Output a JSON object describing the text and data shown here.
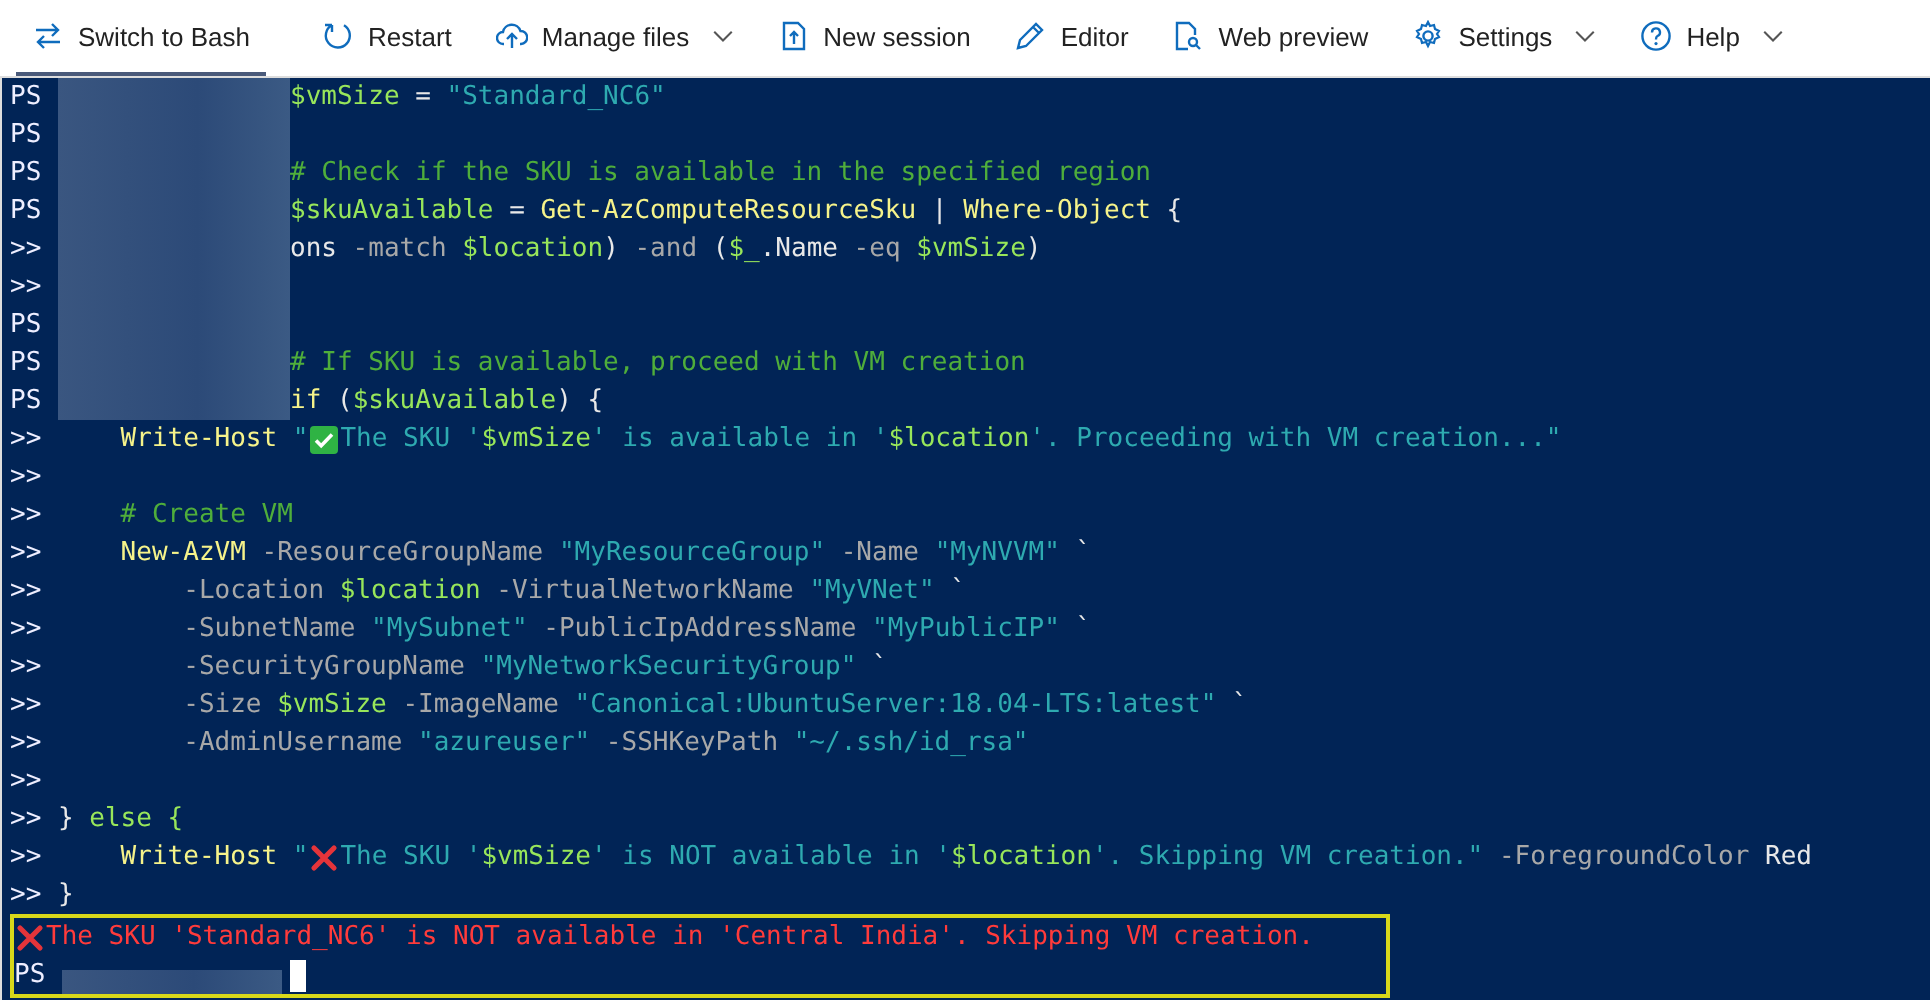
{
  "toolbar": {
    "items": [
      {
        "label": "Switch to Bash",
        "kind": "tab"
      },
      {
        "label": "Restart",
        "kind": "button"
      },
      {
        "label": "Manage files",
        "kind": "menu"
      },
      {
        "label": "New session",
        "kind": "button"
      },
      {
        "label": "Editor",
        "kind": "button"
      },
      {
        "label": "Web preview",
        "kind": "button"
      },
      {
        "label": "Settings",
        "kind": "menu"
      },
      {
        "label": "Help",
        "kind": "menu"
      }
    ]
  },
  "terminal": {
    "lines": [
      {
        "prompt": "PS",
        "redacted": true,
        "tokens": [
          {
            "kind": "var",
            "text": "$vmSize"
          },
          {
            "kind": "plain",
            "text": " = "
          },
          {
            "kind": "str",
            "text": "\"Standard_NC6\""
          }
        ]
      },
      {
        "prompt": "PS",
        "redacted": true
      },
      {
        "prompt": "PS",
        "redacted": true,
        "tokens": [
          {
            "kind": "comment",
            "text": "# Check if the SKU is available in the specified region"
          }
        ]
      },
      {
        "prompt": "PS",
        "redacted": true,
        "tokens": [
          {
            "kind": "var",
            "text": "$skuAvailable"
          },
          {
            "kind": "plain",
            "text": " = "
          },
          {
            "kind": "cmd",
            "text": "Get-AzComputeResourceSku"
          },
          {
            "kind": "plain",
            "text": " | "
          },
          {
            "kind": "cmd",
            "text": "Where-Object"
          },
          {
            "kind": "plain",
            "text": " {"
          }
        ]
      },
      {
        "prompt": ">>",
        "redacted": true,
        "tokens": [
          {
            "kind": "plain",
            "text": "ons"
          },
          {
            "kind": "op",
            "text": " -match "
          },
          {
            "kind": "var",
            "text": "$location"
          },
          {
            "kind": "plain",
            "text": ")"
          },
          {
            "kind": "op",
            "text": " -and "
          },
          {
            "kind": "plain",
            "text": "("
          },
          {
            "kind": "var",
            "text": "$_"
          },
          {
            "kind": "plain",
            "text": ".Name"
          },
          {
            "kind": "op",
            "text": " -eq "
          },
          {
            "kind": "var",
            "text": "$vmSize"
          },
          {
            "kind": "plain",
            "text": ")"
          }
        ]
      },
      {
        "prompt": ">>",
        "redacted": true
      },
      {
        "prompt": "PS",
        "redacted": true
      },
      {
        "prompt": "PS",
        "redacted": true,
        "tokens": [
          {
            "kind": "comment",
            "text": "# If SKU is available, proceed with VM creation"
          }
        ]
      },
      {
        "prompt": "PS",
        "redacted": true,
        "tokens": [
          {
            "kind": "cmd",
            "text": "if"
          },
          {
            "kind": "plain",
            "text": " ("
          },
          {
            "kind": "var",
            "text": "$skuAvailable"
          },
          {
            "kind": "plain",
            "text": ") {"
          }
        ]
      },
      {
        "prompt": ">>",
        "tokens": [
          {
            "kind": "cmd",
            "text": "    Write-Host"
          },
          {
            "kind": "str",
            "text": " \""
          },
          {
            "kind": "check"
          },
          {
            "kind": "str",
            "text": "The SKU '"
          },
          {
            "kind": "var",
            "text": "$vmSize"
          },
          {
            "kind": "str",
            "text": "' is available in '"
          },
          {
            "kind": "var",
            "text": "$location"
          },
          {
            "kind": "str",
            "text": "'. Proceeding with VM creation...\""
          }
        ]
      },
      {
        "prompt": ">>"
      },
      {
        "prompt": ">>",
        "tokens": [
          {
            "kind": "comment",
            "text": "    # Create VM"
          }
        ]
      },
      {
        "prompt": ">>",
        "tokens": [
          {
            "kind": "cmd",
            "text": "    New-AzVM"
          },
          {
            "kind": "op",
            "text": " -ResourceGroupName "
          },
          {
            "kind": "str",
            "text": "\"MyResourceGroup\""
          },
          {
            "kind": "op",
            "text": " -Name "
          },
          {
            "kind": "str",
            "text": "\"MyNVVM\""
          },
          {
            "kind": "plain",
            "text": " `"
          }
        ]
      },
      {
        "prompt": ">>",
        "tokens": [
          {
            "kind": "op",
            "text": "        -Location "
          },
          {
            "kind": "var",
            "text": "$location"
          },
          {
            "kind": "op",
            "text": " -VirtualNetworkName "
          },
          {
            "kind": "str",
            "text": "\"MyVNet\""
          },
          {
            "kind": "plain",
            "text": " `"
          }
        ]
      },
      {
        "prompt": ">>",
        "tokens": [
          {
            "kind": "op",
            "text": "        -SubnetName "
          },
          {
            "kind": "str",
            "text": "\"MySubnet\""
          },
          {
            "kind": "op",
            "text": " -PublicIpAddressName "
          },
          {
            "kind": "str",
            "text": "\"MyPublicIP\""
          },
          {
            "kind": "plain",
            "text": " `"
          }
        ]
      },
      {
        "prompt": ">>",
        "tokens": [
          {
            "kind": "op",
            "text": "        -SecurityGroupName "
          },
          {
            "kind": "str",
            "text": "\"MyNetworkSecurityGroup\""
          },
          {
            "kind": "plain",
            "text": " `"
          }
        ]
      },
      {
        "prompt": ">>",
        "tokens": [
          {
            "kind": "op",
            "text": "        -Size "
          },
          {
            "kind": "var",
            "text": "$vmSize"
          },
          {
            "kind": "op",
            "text": " -ImageName "
          },
          {
            "kind": "str",
            "text": "\"Canonical:UbuntuServer:18.04-LTS:latest\""
          },
          {
            "kind": "plain",
            "text": " `"
          }
        ]
      },
      {
        "prompt": ">>",
        "tokens": [
          {
            "kind": "op",
            "text": "        -AdminUsername "
          },
          {
            "kind": "str",
            "text": "\"azureuser\""
          },
          {
            "kind": "op",
            "text": " -SSHKeyPath "
          },
          {
            "kind": "str",
            "text": "\"~/.ssh/id_rsa\""
          }
        ]
      },
      {
        "prompt": ">>"
      },
      {
        "prompt": ">>",
        "tokens": [
          {
            "kind": "plain",
            "text": "}"
          },
          {
            "kind": "var",
            "text": " else {"
          }
        ]
      },
      {
        "prompt": ">>",
        "tokens": [
          {
            "kind": "cmd",
            "text": "    Write-Host"
          },
          {
            "kind": "str",
            "text": " \""
          },
          {
            "kind": "cross"
          },
          {
            "kind": "str",
            "text": "The SKU '"
          },
          {
            "kind": "var",
            "text": "$vmSize"
          },
          {
            "kind": "str",
            "text": "' is NOT available in '"
          },
          {
            "kind": "var",
            "text": "$location"
          },
          {
            "kind": "str",
            "text": "'. Skipping VM creation.\""
          },
          {
            "kind": "op",
            "text": " -ForegroundColor "
          },
          {
            "kind": "plain",
            "text": "Red"
          }
        ]
      },
      {
        "prompt": ">>",
        "tokens": [
          {
            "kind": "plain",
            "text": "}"
          }
        ]
      }
    ],
    "output": {
      "text": "The SKU 'Standard_NC6' is NOT available in 'Central India'. Skipping VM creation.",
      "highlighted": true
    },
    "current_prompt": {
      "prompt": "PS",
      "redacted": true
    }
  }
}
